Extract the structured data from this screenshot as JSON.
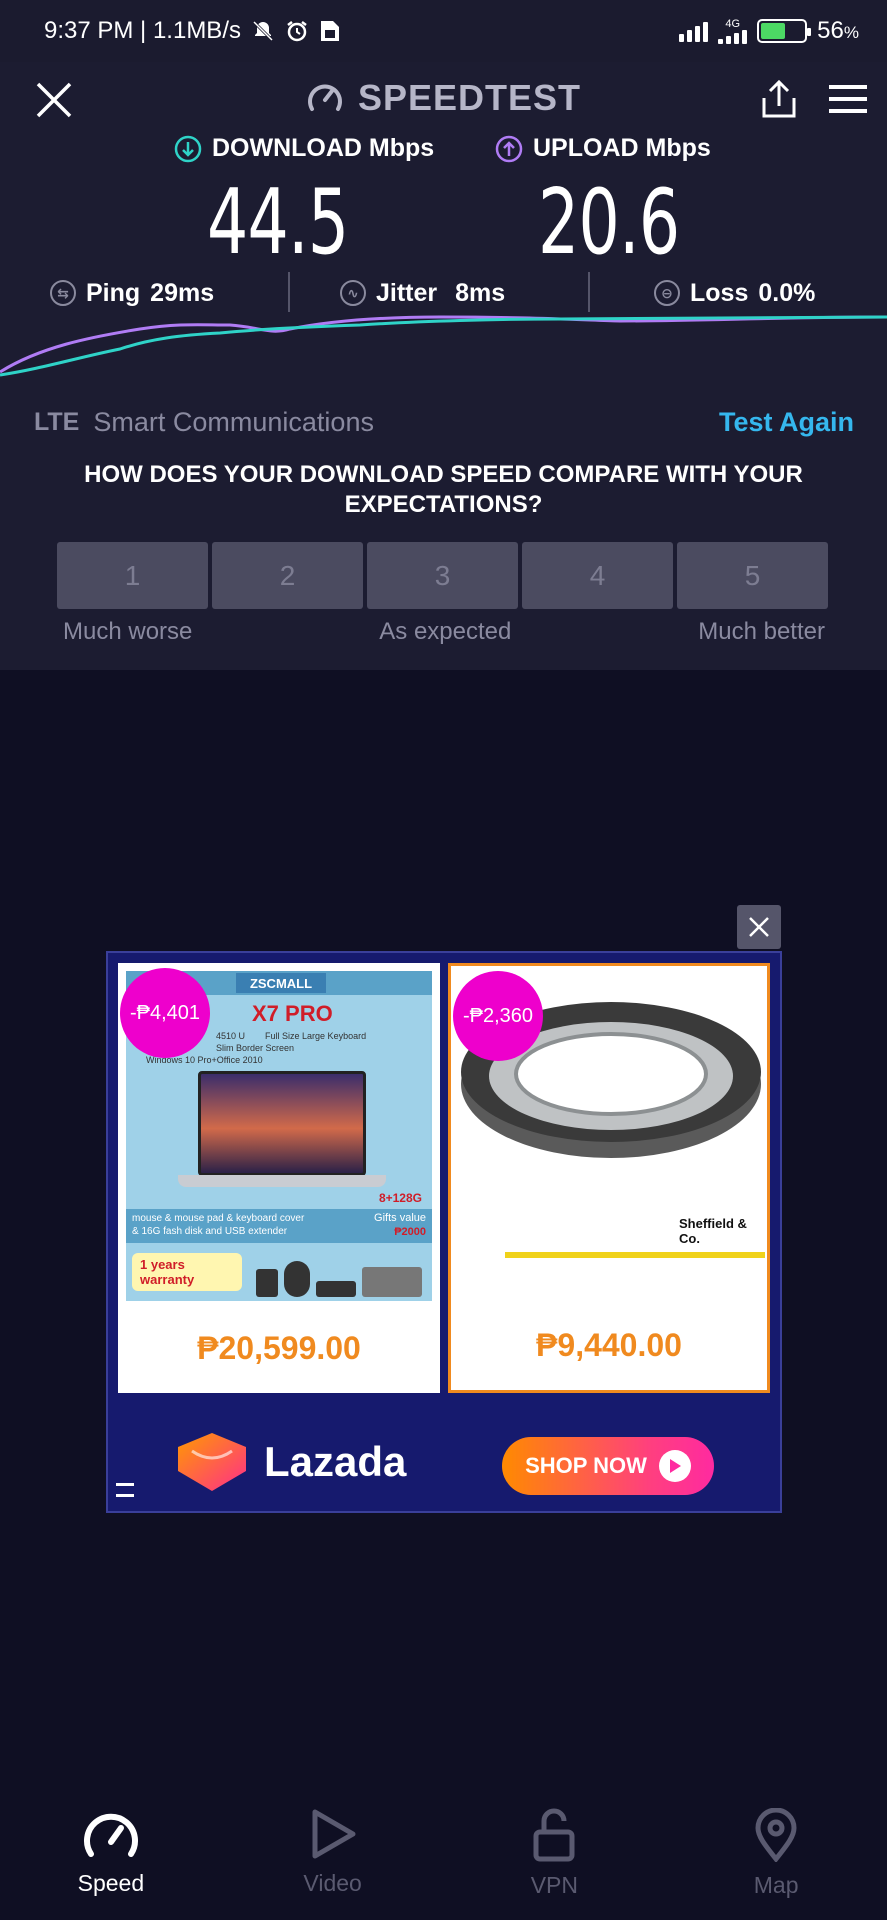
{
  "status_bar": {
    "time_speed": "9:37 PM | 1.1MB/s",
    "network": "4G",
    "battery_percent": "56",
    "battery_level": 0.56,
    "percent_sign": "%"
  },
  "header": {
    "brand": "SPEEDTEST"
  },
  "results": {
    "download_label": "DOWNLOAD Mbps",
    "download_value": "44.5",
    "upload_label": "UPLOAD Mbps",
    "upload_value": "20.6",
    "ping_label": "Ping",
    "ping_value": "29ms",
    "jitter_label": "Jitter",
    "jitter_value": "8ms",
    "loss_label": "Loss",
    "loss_value": "0.0%"
  },
  "provider": {
    "technology": "LTE",
    "name": "Smart Communications",
    "test_again": "Test Again"
  },
  "survey": {
    "question": "HOW DOES YOUR DOWNLOAD SPEED COMPARE WITH YOUR EXPECTATIONS?",
    "options": [
      "1",
      "2",
      "3",
      "4",
      "5"
    ],
    "low_caption": "Much worse",
    "mid_caption": "As expected",
    "high_caption": "Much better"
  },
  "ad": {
    "products": [
      {
        "discount": "-₱4,401",
        "price": "₱20,599.00",
        "logo": "ZSCMALL",
        "title": "X7 PRO",
        "specs": [
          "4510 U",
          "Full Size Large Keyboard",
          "Slim Border Screen",
          "Windows 10 Pro+Office 2010"
        ],
        "spec_tag": "8+128G",
        "bundle": "mouse & mouse pad & keyboard cover & 16G fash disk and USB extender",
        "gift_label": "Gifts value",
        "gift_value": "₱2000",
        "warranty": "1 years warranty"
      },
      {
        "discount": "-₱2,360",
        "price": "₱9,440.00",
        "brand": "Sheffield & Co."
      }
    ],
    "store": "Lazada",
    "cta": "SHOP NOW"
  },
  "nav": {
    "items": [
      {
        "label": "Speed",
        "icon": "speedometer-icon"
      },
      {
        "label": "Video",
        "icon": "play-icon"
      },
      {
        "label": "VPN",
        "icon": "lock-icon"
      },
      {
        "label": "Map",
        "icon": "map-pin-icon"
      }
    ]
  },
  "colors": {
    "download_accent": "#2fd3c8",
    "upload_accent": "#b07cf5",
    "link_accent": "#35b7ee",
    "ad_price": "#f08a1f",
    "ad_discount": "#ee00cc"
  }
}
